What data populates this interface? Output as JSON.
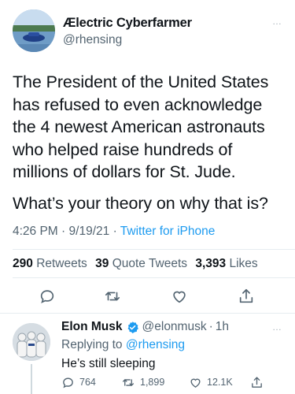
{
  "main_tweet": {
    "display_name": "Ælectric Cyberfarmer",
    "handle": "@rhensing",
    "paragraphs": [
      "The President of the United States has refused to even acknowledge the 4 newest American astronauts who helped raise hundreds of millions of dollars for St. Jude.",
      "What’s your theory on why that is?"
    ],
    "time": "4:26 PM",
    "date": "9/19/21",
    "separator": "·",
    "app": "Twitter for iPhone",
    "stats": {
      "retweets_count": "290",
      "retweets_label": "Retweets",
      "quotes_count": "39",
      "quotes_label": "Quote Tweets",
      "likes_count": "3,393",
      "likes_label": "Likes"
    },
    "more_icon": "…",
    "icons": [
      "reply-icon",
      "retweet-icon",
      "like-icon",
      "share-icon"
    ]
  },
  "reply": {
    "display_name": "Elon Musk",
    "handle": "@elonmusk",
    "separator": "·",
    "age": "1h",
    "replying_prefix": "Replying to",
    "replying_to": "@rhensing",
    "text": "He’s still sleeping",
    "reply_count": "764",
    "retweet_count": "1,899",
    "like_count": "12.1K",
    "more_icon": "…",
    "verified_color": "#1d9bf0"
  },
  "colors": {
    "accent": "#1d9bf0",
    "secondary_text": "#536471",
    "primary_text": "#0f1419",
    "divider": "#e6ecf0"
  }
}
